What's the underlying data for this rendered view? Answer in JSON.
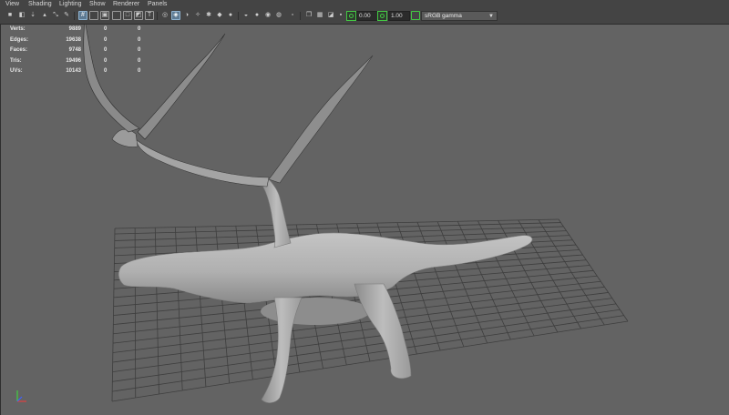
{
  "menu": [
    "View",
    "Shading",
    "Lighting",
    "Show",
    "Renderer",
    "Panels"
  ],
  "toolbar": {
    "exposure_value": "0.00",
    "gamma_value": "1.00",
    "color_space": "sRGB gamma"
  },
  "hud": {
    "rows": [
      {
        "label": "Verts:",
        "v1": "9889",
        "v2": "0",
        "v3": "0"
      },
      {
        "label": "Edges:",
        "v1": "19638",
        "v2": "0",
        "v3": "0"
      },
      {
        "label": "Faces:",
        "v1": "9748",
        "v2": "0",
        "v3": "0"
      },
      {
        "label": "Tris:",
        "v1": "19496",
        "v2": "0",
        "v3": "0"
      },
      {
        "label": "UVs:",
        "v1": "10143",
        "v2": "0",
        "v3": "0"
      }
    ]
  },
  "colors": {
    "viewport_bg": "#636363",
    "grid": "#3e3e3e",
    "model_fill": "#b6b6b6",
    "accent_green": "#43c943",
    "axis_x": "#e04040",
    "axis_y": "#40d040",
    "axis_z": "#4060ff"
  }
}
